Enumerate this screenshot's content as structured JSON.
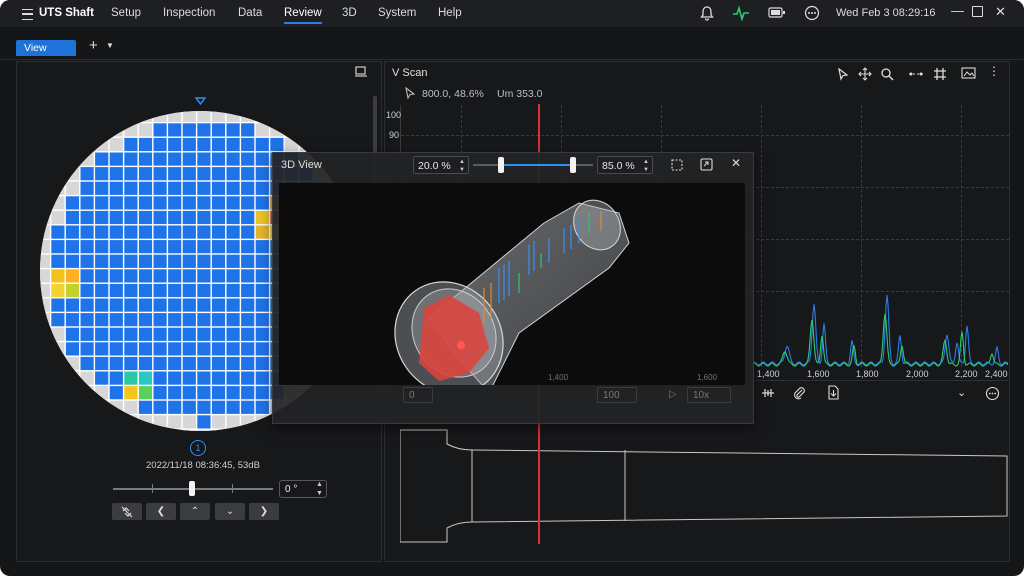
{
  "app": {
    "title": "UTS Shaft"
  },
  "menu": [
    "Setup",
    "Inspection",
    "Data",
    "Review",
    "3D",
    "System",
    "Help"
  ],
  "active_menu": "Review",
  "datetime": "Wed Feb 3  08:29:16",
  "tabs": {
    "view_label": "View",
    "add_label": "+"
  },
  "left": {
    "index_badge": "1",
    "timestamp": "2022/11/18 08:36:45, 53dB",
    "angle_value": "0 °",
    "slider_value": 0.5
  },
  "vscan": {
    "title": "V Scan",
    "cursor_readout": "800.0, 48.6%",
    "um_readout": "Um 353.0",
    "y_ticks": [
      "100",
      "90"
    ],
    "x_ticks": [
      "1,400",
      "1,600",
      "1,800",
      "2,000",
      "2,200",
      "2,400"
    ]
  },
  "view3d": {
    "title": "3D View",
    "min_value": "20.0 %",
    "max_value": "85.0 %",
    "range_low": 0.2,
    "range_high": 0.85,
    "frame_value": "0",
    "frame_total": "100",
    "speed": "10x",
    "under_ticks": [
      "1,400",
      "1,600",
      "1,800",
      "2,000"
    ]
  },
  "colors": {
    "accent": "#2f7be0",
    "grid_blue": "#1f73e8",
    "cursor_red": "#e03030",
    "trace_green": "#2ecc71",
    "trace_blue": "#2b7de9"
  }
}
